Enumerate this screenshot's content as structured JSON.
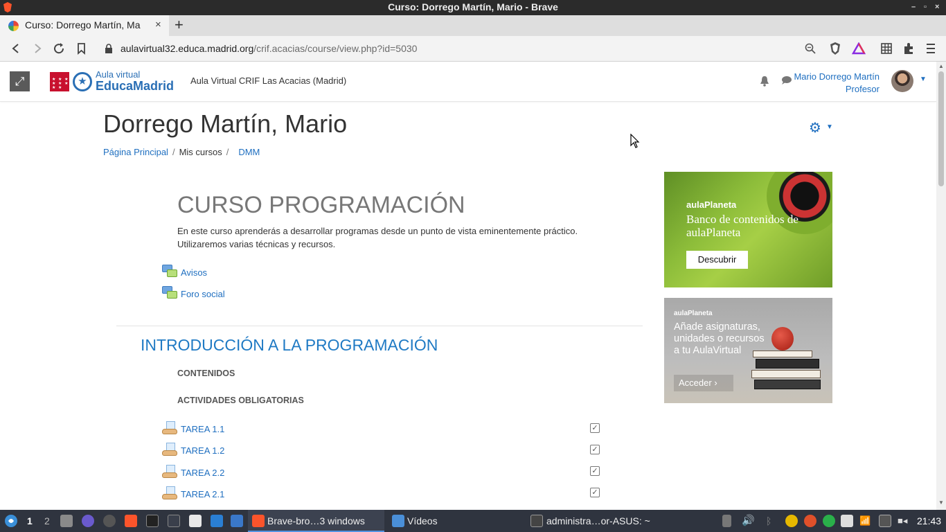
{
  "window": {
    "title": "Curso: Dorrego Martín, Mario - Brave",
    "controls": [
      "–",
      "▫",
      "×"
    ]
  },
  "tab": {
    "title": "Curso: Dorrego Martín, Ma",
    "close": "×",
    "new_tab": "+"
  },
  "address": {
    "host": "aulavirtual32.educa.madrid.org",
    "path": "/crif.acacias/course/view.php?id=5030"
  },
  "navbar": {
    "logo_small": "Aula virtual",
    "logo_big": "EducaMadrid",
    "site_name": "Aula Virtual CRIF Las Acacias (Madrid)",
    "user_name": "Mario Dorrego Martín",
    "user_role": "Profesor"
  },
  "page": {
    "title": "Dorrego Martín, Mario",
    "breadcrumb": [
      "Página Principal",
      "Mis cursos",
      "DMM"
    ]
  },
  "course": {
    "title": "CURSO PROGRAMACIÓN",
    "description": "En este curso aprenderás a desarrollar programas desde un punto de vista eminentemente práctico. Utilizaremos varias técnicas y recursos.",
    "forums": [
      "Avisos",
      "Foro social"
    ],
    "section": {
      "title": "INTRODUCCIÓN A LA PROGRAMACIÓN",
      "labels": [
        "CONTENIDOS",
        "ACTIVIDADES OBLIGATORIAS"
      ],
      "assignments": [
        "TAREA 1.1",
        "TAREA 1.2",
        "TAREA 2.2",
        "TAREA 2.1"
      ]
    }
  },
  "ads": {
    "ad1": {
      "brand": "aulaPlaneta",
      "headline": "Banco de contenidos de aulaPlaneta",
      "button": "Descubrir"
    },
    "ad2": {
      "brand": "aulaPlaneta",
      "headline": "Añade asignaturas, unidades o recursos a tu AulaVirtual",
      "button": "Acceder"
    }
  },
  "taskbar": {
    "workspaces": [
      "1",
      "2"
    ],
    "brave_window": "Brave-bro…3 windows",
    "videos_window": "Vídeos",
    "terminal_window": "administra…or-ASUS: ~",
    "clock": "21:43"
  },
  "colors": {
    "link": "#1f6fc0",
    "section_title": "#1f7ac4",
    "taskbar_bg": "#2f343f"
  },
  "icons": [
    "brave-icon",
    "back-icon",
    "forward-icon",
    "reload-icon",
    "bookmark-icon",
    "lock-icon",
    "zoom-icon",
    "brave-shield-icon",
    "rewards-icon",
    "grid-icon",
    "extensions-icon",
    "menu-icon",
    "expand-icon",
    "bell-icon",
    "chat-icon",
    "gear-icon",
    "forum-icon",
    "assignment-icon",
    "checkbox-icon"
  ]
}
